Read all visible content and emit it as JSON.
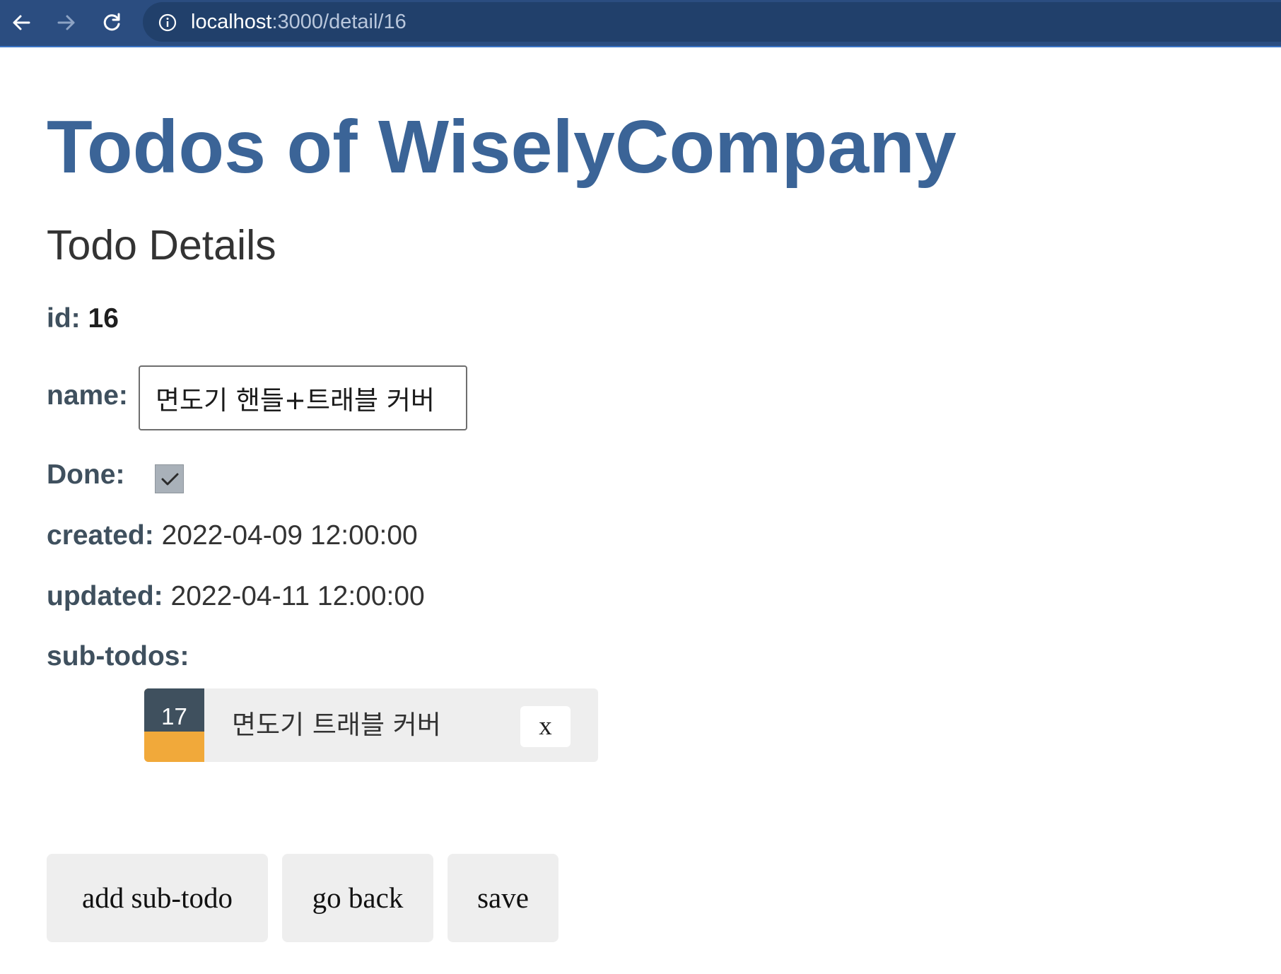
{
  "browser": {
    "url_host": "localhost",
    "url_path": ":3000/detail/16",
    "icons": {
      "back": "arrow-left-icon",
      "forward": "arrow-right-icon",
      "reload": "reload-icon",
      "site_info": "info-icon"
    }
  },
  "page": {
    "title": "Todos of WiselyCompany",
    "subtitle": "Todo Details"
  },
  "todo": {
    "id_label": "id:",
    "id_value": "16",
    "name_label": "name:",
    "name_value": "면도기 핸들+트래블 커버",
    "done_label": "Done:",
    "done_checked": true,
    "created_label": "created:",
    "created_value": "2022-04-09 12:00:00",
    "updated_label": "updated:",
    "updated_value": "2022-04-11 12:00:00",
    "subtodos_label": "sub-todos:"
  },
  "subtodos": [
    {
      "id": "17",
      "name": "면도기 트래블 커버",
      "delete_label": "x"
    }
  ],
  "actions": {
    "add_subtodo": "add sub-todo",
    "go_back": "go back",
    "save": "save"
  },
  "colors": {
    "toolbar": "#2b4d80",
    "title": "#3b6497",
    "label": "#3f505e",
    "badge_bottom": "#f1a93a",
    "card_bg": "#eeeeee"
  }
}
